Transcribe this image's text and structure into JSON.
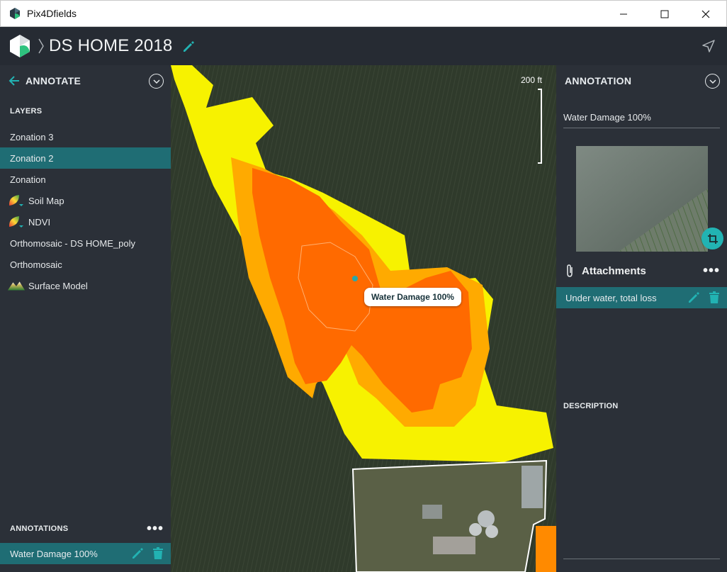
{
  "window": {
    "app_title": "Pix4Dfields"
  },
  "header": {
    "project_title": "DS HOME 2018"
  },
  "left_panel": {
    "title": "ANNOTATE",
    "layers_label": "LAYERS",
    "layers": [
      {
        "label": "Zonation 3",
        "icon": "",
        "selected": false
      },
      {
        "label": "Zonation 2",
        "icon": "",
        "selected": true
      },
      {
        "label": "Zonation",
        "icon": "",
        "selected": false
      },
      {
        "label": "Soil Map",
        "icon": "leaf-gradient-icon",
        "selected": false
      },
      {
        "label": "NDVI",
        "icon": "leaf-gradient-icon",
        "selected": false
      },
      {
        "label": "Orthomosaic - DS HOME_poly",
        "icon": "",
        "selected": false
      },
      {
        "label": "Orthomosaic",
        "icon": "",
        "selected": false
      },
      {
        "label": "Surface Model",
        "icon": "mountain-icon",
        "selected": false
      }
    ],
    "annotations_label": "ANNOTATIONS",
    "annotations": [
      {
        "label": "Water Damage 100%"
      }
    ]
  },
  "map": {
    "scale_label": "200 ft",
    "tooltip": "Water Damage 100%",
    "zone_colors": {
      "low": "#f7f200",
      "mid": "#ffaa00",
      "high": "#ff6a00"
    }
  },
  "right_panel": {
    "title": "ANNOTATION",
    "annotation_name": "Water Damage 100%",
    "attachments_title": "Attachments",
    "attachments": [
      {
        "label": "Under water, total loss"
      }
    ],
    "description_label": "DESCRIPTION"
  },
  "colors": {
    "accent": "#1f6d74",
    "teal_icon": "#22b3b3",
    "panel_bg": "#2b3038"
  }
}
